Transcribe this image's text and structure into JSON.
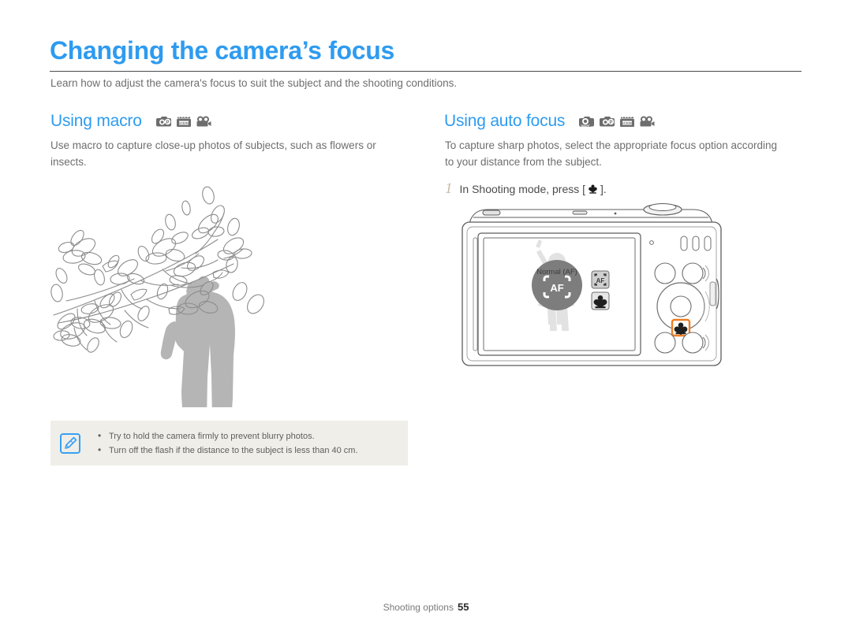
{
  "document": {
    "title": "Changing the camera’s focus",
    "intro": "Learn how to adjust the camera's focus to suit the subject and the shooting conditions.",
    "footer_label": "Shooting options",
    "footer_page": "55"
  },
  "colors": {
    "heading_blue": "#2e9bf0",
    "body_gray": "#6e6e6e",
    "note_bg": "#efeee8",
    "note_icon_blue": "#38a0f5",
    "step_number_tan": "#c8b9a6",
    "highlight_orange": "#f07d22",
    "outline_gray": "#585858"
  },
  "sections": [
    {
      "id": "macro",
      "heading": "Using macro",
      "mode_icons": [
        "camera-program-icon",
        "scene-icon",
        "movie-icon"
      ],
      "body": "Use macro to capture close-up photos of subjects, such as flowers or insects."
    },
    {
      "id": "auto-focus",
      "heading": "Using auto focus",
      "mode_icons": [
        "camera-smart-icon",
        "camera-program-icon",
        "scene-icon",
        "movie-icon"
      ],
      "body": "To capture sharp photos, select the appropriate focus option according to your distance from the subject.",
      "steps": [
        {
          "number": "1",
          "text_before": "In Shooting mode, press [",
          "icon": "macro-flower-icon",
          "text_after": "]."
        }
      ]
    }
  ],
  "note": {
    "icon": "note-pen-icon",
    "items": [
      "Try to hold the camera firmly to prevent blurry photos.",
      "Turn off the flash if the distance to the subject is less than 40 cm."
    ]
  },
  "illustrations": {
    "macro_scene": {
      "name": "magnolia-branch-with-photographer",
      "description": "Line drawing of a magnolia branch in bloom with a gray silhouette of a person taking a photograph"
    },
    "camera_back": {
      "name": "camera-back-view",
      "lcd": {
        "label": "Normal (AF)",
        "selected_option": "af-icon",
        "options": [
          "af-icon",
          "macro-flower-icon"
        ]
      },
      "highlighted_button": "macro-button",
      "highlight_color": "#f07d22"
    }
  }
}
